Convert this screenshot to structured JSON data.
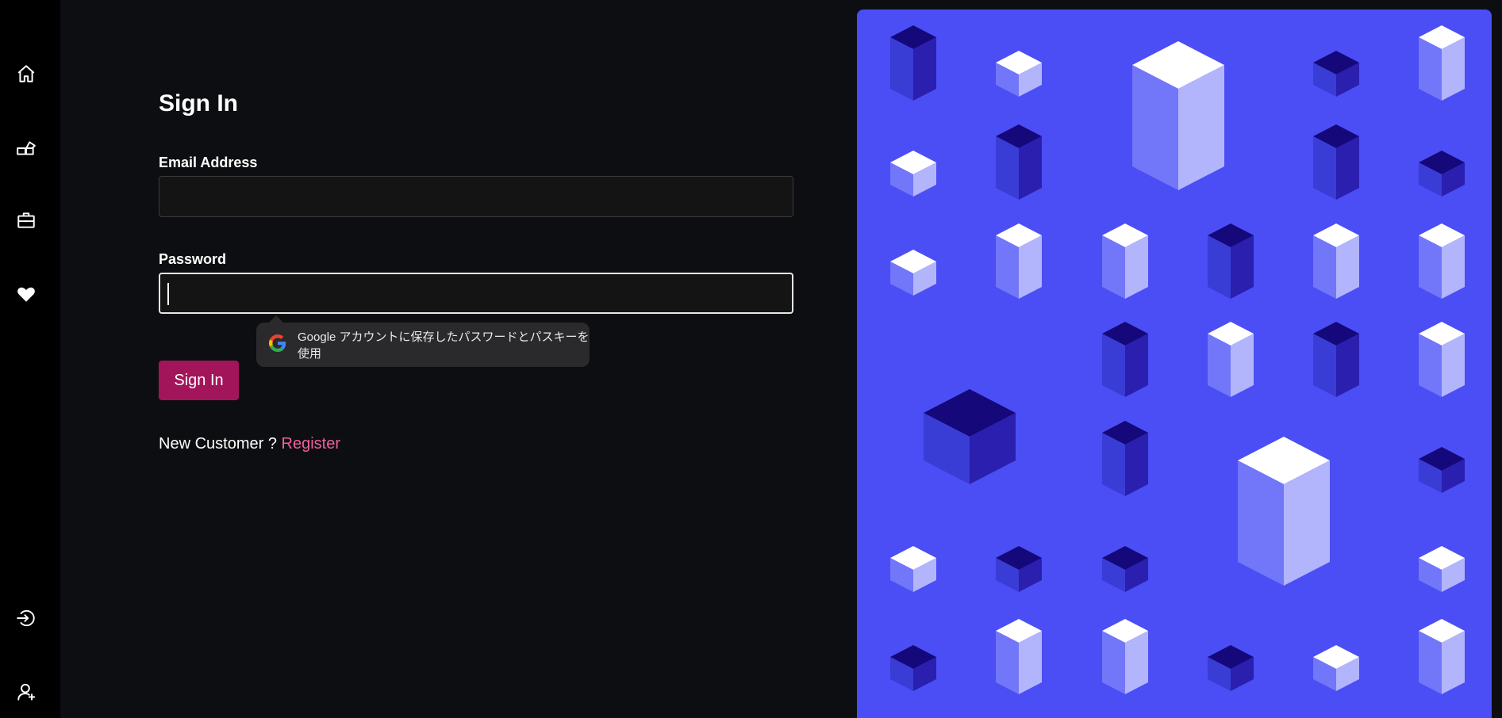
{
  "sidebar": {
    "items": [
      {
        "name": "home",
        "icon": "home-icon"
      },
      {
        "name": "shop",
        "icon": "shop-icon"
      },
      {
        "name": "briefcase",
        "icon": "briefcase-icon"
      },
      {
        "name": "favorites",
        "icon": "heart-icon"
      }
    ],
    "bottom_items": [
      {
        "name": "login",
        "icon": "login-icon"
      },
      {
        "name": "register-user",
        "icon": "user-add-icon"
      }
    ]
  },
  "form": {
    "title": "Sign In",
    "email_label": "Email Address",
    "email_value": "",
    "password_label": "Password",
    "password_value": "",
    "submit_label": "Sign In",
    "new_customer_text": "New Customer ?",
    "register_link": "Register"
  },
  "passkey_tooltip": {
    "icon": "google-icon",
    "text": "Google アカウントに保存したパスワードとパスキーを使用"
  },
  "colors": {
    "page_bg": "#0d0e11",
    "sidebar_bg": "#000000",
    "primary_button": "#a3155a",
    "link": "#f0609e",
    "art_bg": "#4a4ef4"
  }
}
